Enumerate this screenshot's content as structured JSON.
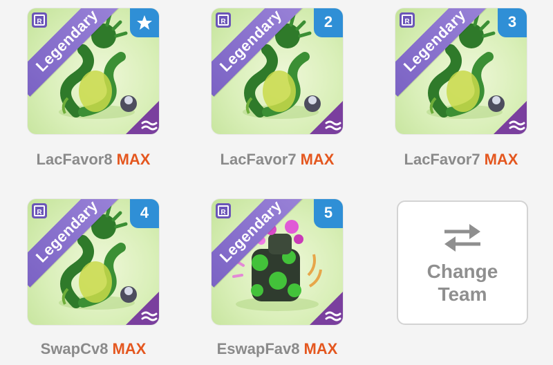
{
  "team": [
    {
      "rarity": "Legendary",
      "slot": "",
      "slot_icon": "star-icon",
      "name": "LacFavor8",
      "level": "MAX",
      "monster": "hydra-serpent",
      "element": "water-wave-icon"
    },
    {
      "rarity": "Legendary",
      "slot": "2",
      "name": "LacFavor7",
      "level": "MAX",
      "monster": "hydra-serpent",
      "element": "water-wave-icon"
    },
    {
      "rarity": "Legendary",
      "slot": "3",
      "name": "LacFavor7",
      "level": "MAX",
      "monster": "hydra-serpent",
      "element": "water-wave-icon"
    },
    {
      "rarity": "Legendary",
      "slot": "4",
      "name": "SwapCv8",
      "level": "MAX",
      "monster": "hydra-serpent",
      "element": "water-wave-icon"
    },
    {
      "rarity": "Legendary",
      "slot": "5",
      "name": "EswapFav8",
      "level": "MAX",
      "monster": "flower-golem",
      "element": "water-wave-icon"
    }
  ],
  "change_team": {
    "line1": "Change",
    "line2": "Team",
    "icon": "swap-arrows-icon"
  },
  "colors": {
    "legendary_band": "#8b73cf",
    "slot_badge": "#2f8fd6",
    "element_badge": "#7a3f9e",
    "max_label": "#e4571f",
    "name_label": "#8a8a8a"
  }
}
